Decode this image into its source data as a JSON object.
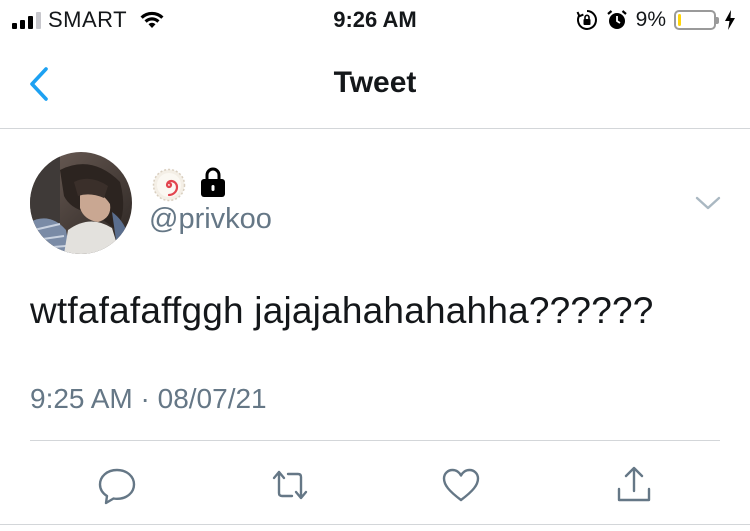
{
  "status_bar": {
    "carrier": "SMART",
    "time": "9:26 AM",
    "battery_percent": "9%",
    "battery_level": 0.09,
    "icons": [
      "signal-icon",
      "wifi-icon",
      "rotation-lock-icon",
      "alarm-icon",
      "battery-icon",
      "charging-bolt-icon"
    ]
  },
  "nav": {
    "title": "Tweet",
    "back_icon": "chevron-left-icon"
  },
  "tweet": {
    "avatar": "avatar",
    "badge_icon": "swirl-emoji-icon",
    "protected_icon": "lock-icon",
    "handle": "@privkoo",
    "text": "wtfafafaffggh jajajahahahahha??????",
    "time": "9:25 AM",
    "separator": " · ",
    "date": "08/07/21",
    "menu_icon": "chevron-down-icon"
  },
  "actions": [
    "reply-icon",
    "retweet-icon",
    "like-icon",
    "share-icon"
  ],
  "colors": {
    "accent": "#1da1f2",
    "secondary_text": "#657786",
    "icon_gray": "#657786",
    "divider": "#d3d6d9",
    "battery": "#ffd60a"
  }
}
